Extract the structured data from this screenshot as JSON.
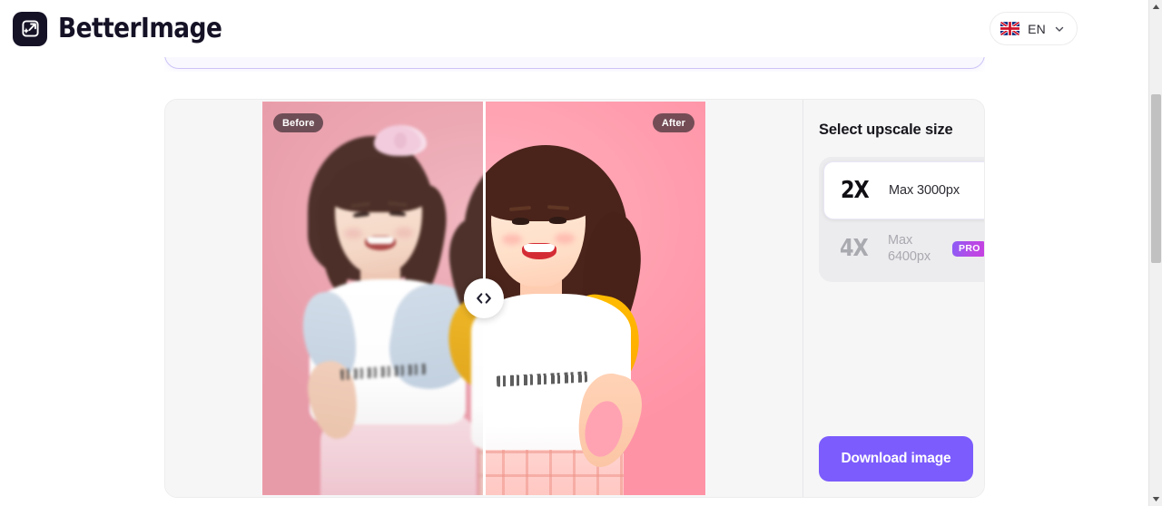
{
  "header": {
    "brand_name": "BetterImage",
    "logo_icon": "expand-sparkle-icon",
    "language": {
      "code": "EN",
      "flag_icon": "uk-flag-icon",
      "chevron_icon": "chevron-down-icon"
    }
  },
  "dropzone": {
    "name": "upload-dropzone",
    "border_color": "#ccc4f6",
    "fill_color": "#f9f8fe"
  },
  "preview": {
    "before_label": "Before",
    "after_label": "After",
    "handle_icon": "left-right-chevrons-icon",
    "split_percent": 50,
    "background_color": "#f3a3b0"
  },
  "options": {
    "title": "Select upscale size",
    "items": [
      {
        "multiplier": "2X",
        "description": "Max 3000px",
        "selected": true,
        "pro": false,
        "badge": ""
      },
      {
        "multiplier": "4X",
        "description": "Max 6400px",
        "selected": false,
        "pro": true,
        "badge": "PRO"
      }
    ]
  },
  "actions": {
    "download_label": "Download image",
    "download_color": "#7c5cfc"
  },
  "scrollbar": {
    "up_icon": "scroll-up-arrow-icon",
    "down_icon": "scroll-down-arrow-icon",
    "thumb_name": "scrollbar-thumb"
  }
}
